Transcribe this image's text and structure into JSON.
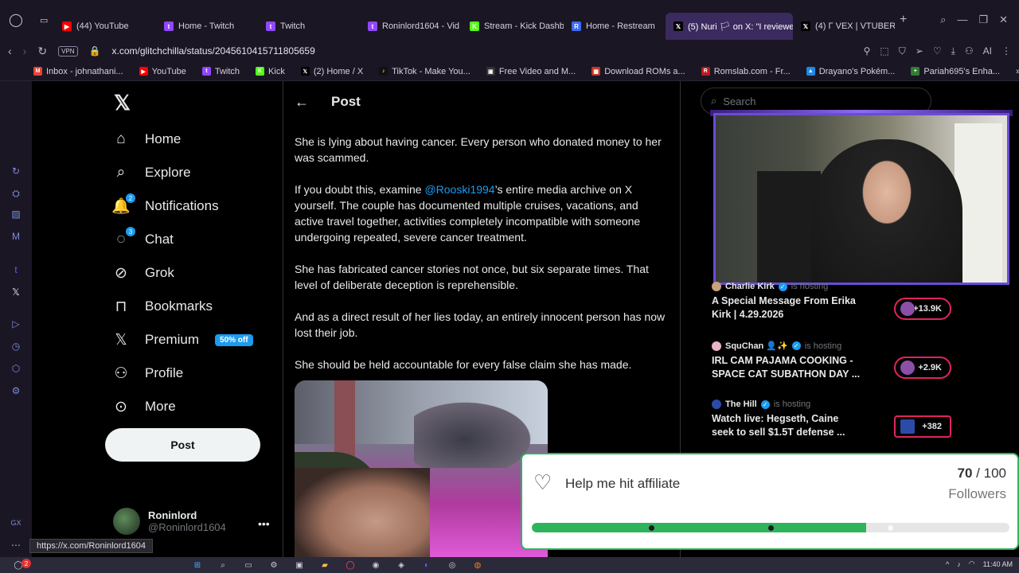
{
  "browser": {
    "tabs": [
      {
        "label": "(44) YouTube",
        "color": "#ff0000",
        "glyph": "▶"
      },
      {
        "label": "Home - Twitch",
        "color": "#9146ff",
        "glyph": "t"
      },
      {
        "label": "Twitch",
        "color": "#9146ff",
        "glyph": "t"
      },
      {
        "label": "Roninlord1604 - Vid",
        "color": "#9146ff",
        "glyph": "t"
      },
      {
        "label": "Stream - Kick Dashb",
        "color": "#53fc18",
        "glyph": "K"
      },
      {
        "label": "Home - Restream",
        "color": "#3b6cf6",
        "glyph": "R"
      },
      {
        "label": "(5) Nuri 🏳 on X: \"I reviewe",
        "color": "#000000",
        "glyph": "𝕏"
      },
      {
        "label": "(4) Γ VEX | VTUBER",
        "color": "#000000",
        "glyph": "𝕏"
      }
    ],
    "active_tab_index": 6,
    "vpn_label": "VPN",
    "url": "x.com/glitchchilla/status/2045610415711805659",
    "ai_label": "AI",
    "bookmarks": [
      {
        "label": "Inbox - johnathani...",
        "color": "#ea4335",
        "glyph": "M"
      },
      {
        "label": "YouTube",
        "color": "#ff0000",
        "glyph": "▶"
      },
      {
        "label": "Twitch",
        "color": "#9146ff",
        "glyph": "t"
      },
      {
        "label": "Kick",
        "color": "#53fc18",
        "glyph": "K"
      },
      {
        "label": "(2) Home / X",
        "color": "#000000",
        "glyph": "𝕏"
      },
      {
        "label": "TikTok - Make You...",
        "color": "#111111",
        "glyph": "♪"
      },
      {
        "label": "Free Video and M...",
        "color": "#333333",
        "glyph": "▣"
      },
      {
        "label": "Download ROMs a...",
        "color": "#c0392b",
        "glyph": "▦"
      },
      {
        "label": "Romslab.com - Fr...",
        "color": "#b71c1c",
        "glyph": "R"
      },
      {
        "label": "Drayano's Pokém...",
        "color": "#1e88e5",
        "glyph": "▲"
      },
      {
        "label": "Pariah695's Enha...",
        "color": "#2e7d32",
        "glyph": "+"
      }
    ]
  },
  "nav": {
    "items": [
      {
        "label": "Home",
        "icon": "home-icon",
        "glyph": "⌂"
      },
      {
        "label": "Explore",
        "icon": "search-icon",
        "glyph": "⌕"
      },
      {
        "label": "Notifications",
        "icon": "bell-icon",
        "glyph": "🔔",
        "badge": "2"
      },
      {
        "label": "Chat",
        "icon": "chat-icon",
        "glyph": "◌",
        "badge": "3"
      },
      {
        "label": "Grok",
        "icon": "grok-icon",
        "glyph": "⊘"
      },
      {
        "label": "Bookmarks",
        "icon": "bookmark-icon",
        "glyph": "⊓"
      },
      {
        "label": "Premium",
        "icon": "x-premium-icon",
        "glyph": "𝕏",
        "promo": "50% off"
      },
      {
        "label": "Profile",
        "icon": "person-icon",
        "glyph": "⚇"
      },
      {
        "label": "More",
        "icon": "more-circle-icon",
        "glyph": "⊙"
      }
    ],
    "post_button": "Post",
    "profile_name": "Roninlord",
    "profile_handle": "@Roninlord1604",
    "status_url": "https://x.com/Roninlord1604"
  },
  "main": {
    "title": "Post",
    "p1": "She is lying about having cancer. Every person who donated money to her was scammed.",
    "p2_pre": "If you doubt this, examine ",
    "p2_mention": "@Rooski1994",
    "p2_post": "’s entire media archive on X yourself. The couple has documented multiple cruises, vacations, and active travel together, activities completely incompatible with someone undergoing repeated, severe cancer treatment.",
    "p3": "She has fabricated cancer stories not once, but six separate times. That level of deliberate deception is reprehensible.",
    "p4": "And as a direct result of her lies today, an entirely innocent person has now lost their job.",
    "p5": "She should be held accountable for every false claim she has made."
  },
  "right": {
    "search_placeholder": "Search",
    "hosts": [
      {
        "name": "Charlie Kirk",
        "status": "is hosting",
        "title": "A Special Message From Erika Kirk | 4.29.2026",
        "count": "+13.9K"
      },
      {
        "name": "SquChan 👤✨",
        "status": "is hosting",
        "title": "IRL CAM PAJAMA COOKING - SPACE CAT SUBATHON DAY ...",
        "count": "+2.9K"
      },
      {
        "name": "The Hill",
        "status": "is hosting",
        "title": "Watch live: Hegseth, Caine seek to sell $1.5T defense ...",
        "count": "+382"
      }
    ]
  },
  "goal": {
    "label": "Help me hit affiliate",
    "current": "70",
    "separator": " / ",
    "target": "100",
    "unit": "Followers",
    "progress": 0.7,
    "milestones": [
      0.25,
      0.5,
      0.75
    ]
  },
  "taskbar": {
    "badge": "2",
    "time": "11:40 AM"
  }
}
